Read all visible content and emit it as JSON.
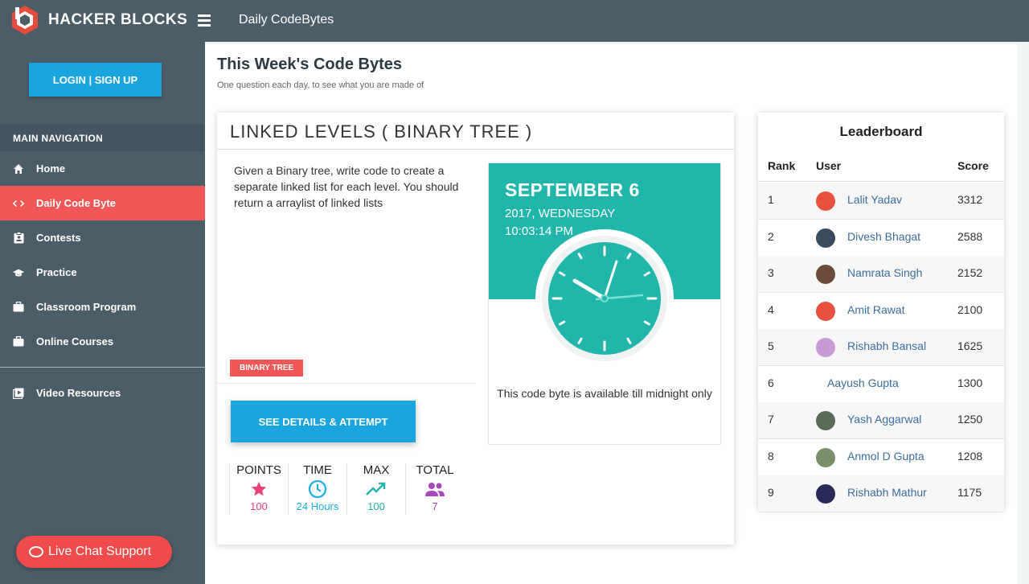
{
  "header": {
    "brand": "HACKER BLOCKS",
    "page_title": "Daily CodeBytes"
  },
  "sidebar": {
    "login_label": "LOGIN | SIGN UP",
    "nav_header": "MAIN NAVIGATION",
    "items": [
      {
        "label": "Home",
        "icon": "home-icon"
      },
      {
        "label": "Daily Code Byte",
        "icon": "code-icon",
        "active": true
      },
      {
        "label": "Contests",
        "icon": "contest-icon"
      },
      {
        "label": "Practice",
        "icon": "graduation-cap-icon"
      },
      {
        "label": "Classroom Program",
        "icon": "briefcase-icon"
      },
      {
        "label": "Online Courses",
        "icon": "briefcase-icon"
      },
      {
        "label": "Video Resources",
        "icon": "video-icon"
      }
    ],
    "chat_label": "Live Chat Support"
  },
  "main": {
    "title": "This Week's Code Bytes",
    "subtitle": "One question each day, to see what you are made of",
    "question": {
      "title": "LINKED LEVELS ( BINARY TREE )",
      "description": "Given a Binary tree, write code to create a separate linked list for each level. You should return a arraylist of linked lists",
      "tag": "BINARY TREE",
      "attempt_label": "SEE DETAILS & ATTEMPT",
      "stats": [
        {
          "label": "POINTS",
          "value": "100",
          "icon": "star-icon",
          "color": "#ec407a"
        },
        {
          "label": "TIME",
          "value": "24 Hours",
          "icon": "clock-icon",
          "color": "#1ab0e3"
        },
        {
          "label": "MAX",
          "value": "100",
          "icon": "trending-up-icon",
          "color": "#21b6ac"
        },
        {
          "label": "TOTAL",
          "value": "7",
          "icon": "people-icon",
          "color": "#ab47bc"
        }
      ]
    },
    "date": {
      "day": "SEPTEMBER 6",
      "year_weekday": "2017, WEDNESDAY",
      "time": "10:03:14 PM",
      "availability": "This code byte is available till midnight only"
    },
    "leaderboard": {
      "title": "Leaderboard",
      "headers": {
        "rank": "Rank",
        "user": "User",
        "score": "Score"
      },
      "rows": [
        {
          "rank": "1",
          "user": "Lalit Yadav",
          "score": "3312",
          "avatar_color": "#e8513d"
        },
        {
          "rank": "2",
          "user": "Divesh Bhagat",
          "score": "2588",
          "avatar_color": "#3a4a5e"
        },
        {
          "rank": "3",
          "user": "Namrata Singh",
          "score": "2152",
          "avatar_color": "#6b4c3b"
        },
        {
          "rank": "4",
          "user": "Amit Rawat",
          "score": "2100",
          "avatar_color": "#e8513d"
        },
        {
          "rank": "5",
          "user": "Rishabh Bansal",
          "score": "1625",
          "avatar_color": "#c79ad6"
        },
        {
          "rank": "6",
          "user": "Aayush Gupta",
          "score": "1300",
          "avatar_color": ""
        },
        {
          "rank": "7",
          "user": "Yash Aggarwal",
          "score": "1250",
          "avatar_color": "#5b6b5a"
        },
        {
          "rank": "8",
          "user": "Anmol D Gupta",
          "score": "1208",
          "avatar_color": "#7a8f6a"
        },
        {
          "rank": "9",
          "user": "Rishabh Mathur",
          "score": "1175",
          "avatar_color": "#2a2a5a"
        }
      ]
    }
  }
}
